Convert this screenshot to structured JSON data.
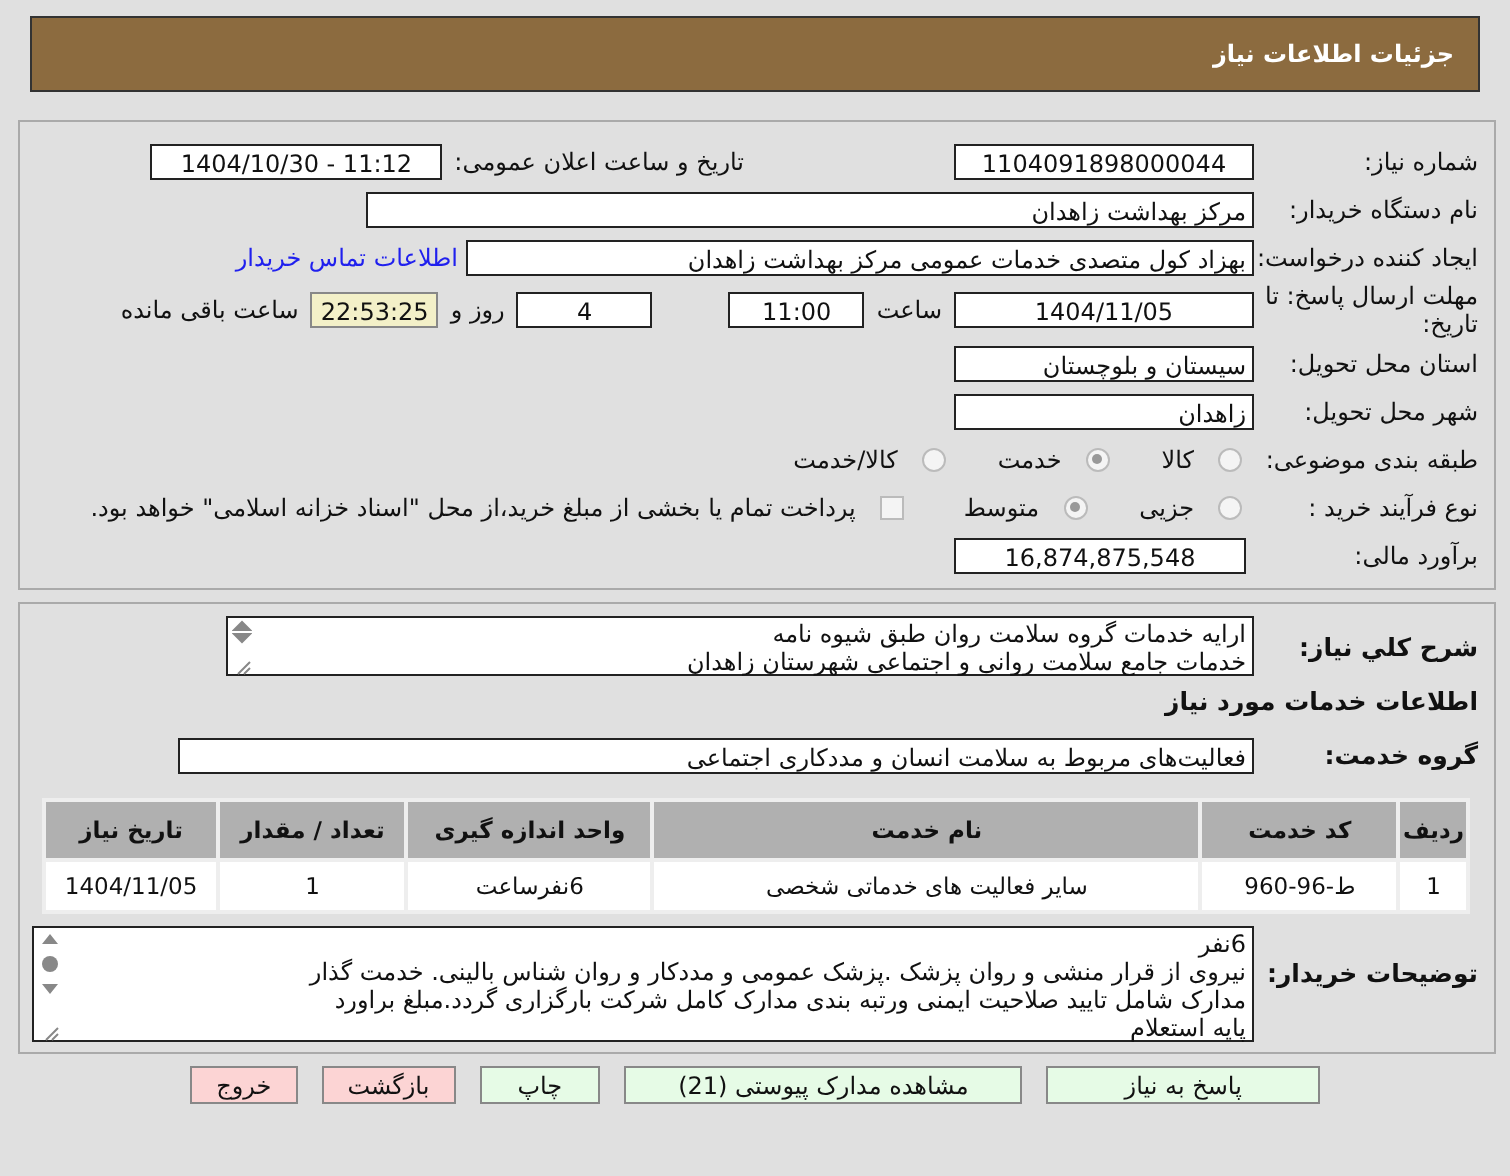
{
  "header": {
    "title": "جزئیات اطلاعات نیاز"
  },
  "need_number": {
    "label": "شماره نیاز:",
    "value": "1104091898000044"
  },
  "announce": {
    "label": "تاریخ و ساعت اعلان عمومی:",
    "value": "1404/10/30 - 11:12"
  },
  "buyer": {
    "label": "نام دستگاه خریدار:",
    "value": "مرکز بهداشت زاهدان"
  },
  "requester": {
    "label": "ایجاد کننده درخواست:",
    "value": "بهزاد کول متصدی خدمات عمومی مرکز بهداشت زاهدان",
    "link": "اطلاعات تماس خریدار"
  },
  "deadline": {
    "label": "مهلت ارسال پاسخ: تا تاریخ:",
    "date": "1404/11/05",
    "time_label": "ساعت",
    "time": "11:00",
    "days": "4",
    "days_label": "روز و",
    "remaining": "22:53:25",
    "remaining_label": "ساعت باقی مانده"
  },
  "province": {
    "label": "استان محل تحویل:",
    "value": "سیستان و بلوچستان"
  },
  "city": {
    "label": "شهر محل تحویل:",
    "value": "زاهدان"
  },
  "category": {
    "label": "طبقه بندی موضوعی:",
    "options": [
      {
        "label": "کالا",
        "selected": false
      },
      {
        "label": "خدمت",
        "selected": true
      },
      {
        "label": "کالا/خدمت",
        "selected": false
      }
    ]
  },
  "purchase_type": {
    "label": "نوع فرآیند خرید :",
    "options": [
      {
        "label": "جزیی",
        "selected": false
      },
      {
        "label": "متوسط",
        "selected": true
      }
    ],
    "payment": {
      "checked": false,
      "label": "پرداخت تمام یا بخشی از مبلغ خرید،از محل \"اسناد خزانه اسلامی\" خواهد بود."
    }
  },
  "budget": {
    "label": "برآورد مالی:",
    "value": "16,874,875,548"
  },
  "description": {
    "label": "شرح کلي نياز:",
    "lines": [
      "ارایه خدمات گروه سلامت روان طبق شیوه نامه",
      "خدمات جامع سلامت روانی و اجتماعی شهرستان زاهدان"
    ]
  },
  "services_heading": "اطلاعات خدمات مورد نیاز",
  "service_group": {
    "label": "گروه خدمت:",
    "value": "فعالیت‌های مربوط به سلامت انسان و مددکاری اجتماعی"
  },
  "table": {
    "columns": [
      "ردیف",
      "کد خدمت",
      "نام خدمت",
      "واحد اندازه گیری",
      "تعداد / مقدار",
      "تاریخ نیاز"
    ],
    "rows": [
      [
        "1",
        "ط-96-960",
        "سایر فعالیت های خدماتی شخصی",
        "6نفرساعت",
        "1",
        "1404/11/05"
      ]
    ]
  },
  "buyer_notes": {
    "label": "توضیحات خریدار:",
    "lines": [
      "6نفر",
      "نیروی از قرار منشی و روان پزشک .پزشک عمومی و مددکار و روان شناس بالینی. خدمت گذار",
      "مدارک شامل تایید صلاحیت ایمنی ورتبه بندی مدارک کامل شرکت بارگزاری گردد.مبلغ براورد",
      "پایه استعلام"
    ]
  },
  "buttons": [
    {
      "label": "پاسخ به نیاز",
      "kind": "normal"
    },
    {
      "label": "مشاهده مدارک پیوستی (21)",
      "kind": "normal"
    },
    {
      "label": "چاپ",
      "kind": "normal"
    },
    {
      "label": "بازگشت",
      "kind": "danger"
    },
    {
      "label": "خروج",
      "kind": "danger"
    }
  ]
}
